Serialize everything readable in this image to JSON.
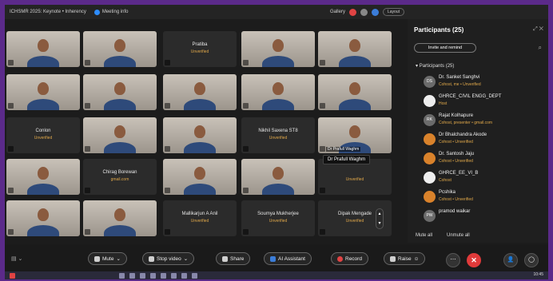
{
  "window": {
    "title": "ICHSMR 2025: Keynote • Inherency",
    "meeting_info": "Meeting info",
    "view_label": "Gallery",
    "layout_label": "Layout"
  },
  "tiles": [
    {
      "type": "video",
      "label": ""
    },
    {
      "type": "video",
      "label": ""
    },
    {
      "type": "text",
      "name": "Pratiba",
      "sub": "Unverified"
    },
    {
      "type": "video",
      "label": ""
    },
    {
      "type": "video",
      "label": ""
    },
    {
      "type": "video",
      "label": ""
    },
    {
      "type": "video",
      "label": ""
    },
    {
      "type": "video",
      "label": ""
    },
    {
      "type": "video",
      "label": ""
    },
    {
      "type": "video",
      "label": ""
    },
    {
      "type": "text",
      "name": "Conlon",
      "sub": "Unverified"
    },
    {
      "type": "video",
      "label": ""
    },
    {
      "type": "video",
      "label": ""
    },
    {
      "type": "text",
      "name": "Nikhil Saxena ST8",
      "sub": "Unverified"
    },
    {
      "type": "video",
      "label": "Dr Prafull Waghm"
    },
    {
      "type": "video",
      "label": ""
    },
    {
      "type": "text",
      "name": "Chirag Borewan",
      "sub": "gmail.com"
    },
    {
      "type": "video",
      "label": ""
    },
    {
      "type": "video",
      "label": ""
    },
    {
      "type": "text",
      "name": "",
      "sub": "Unverified"
    },
    {
      "type": "video",
      "label": ""
    },
    {
      "type": "video",
      "label": ""
    },
    {
      "type": "text",
      "name": "Mallikarjun A Anil",
      "sub": "Unverified"
    },
    {
      "type": "text",
      "name": "Soumya Mukherjee",
      "sub": "Unverified"
    },
    {
      "type": "text",
      "name": "Dipak Mengade",
      "sub": "Unverified"
    }
  ],
  "tooltip": "Dr Prafull Waghm",
  "participants": {
    "title": "Participants (25)",
    "invite_label": "Invite and remind",
    "group_label": "Participants (25)",
    "items": [
      {
        "initials": "DS",
        "name": "Dr. Sanket Sanghvi",
        "sub": "Cohost, me • Unverified",
        "color": "gray"
      },
      {
        "initials": "",
        "name": "GHRCE_CIVIL ENGG_DEPT",
        "sub": "Host",
        "color": "white"
      },
      {
        "initials": "RK",
        "name": "Rajat Kolhapure",
        "sub": "Cohost, presenter • gmail.com",
        "color": "gray"
      },
      {
        "initials": "",
        "name": "Dr Bhalchandra Akode",
        "sub": "Cohost • Unverified",
        "color": "orange"
      },
      {
        "initials": "",
        "name": "Dr. Santosh Jaju",
        "sub": "Cohost • Unverified",
        "color": "orange"
      },
      {
        "initials": "",
        "name": "GHRCE_EE_VI_B",
        "sub": "Cohost",
        "color": "white"
      },
      {
        "initials": "",
        "name": "Pcshika",
        "sub": "Cohost • Unverified",
        "color": "orange"
      },
      {
        "initials": "PW",
        "name": "pramod waikar",
        "sub": "",
        "color": "gray"
      }
    ],
    "mute_all": "Mute all",
    "unmute_all": "Unmute all"
  },
  "toolbar": {
    "mute": "Mute",
    "stop_video": "Stop video",
    "share": "Share",
    "ai_assistant": "AI Assistant",
    "record": "Record",
    "raise": "Raise"
  },
  "taskbar": {
    "clock": "10:45"
  }
}
